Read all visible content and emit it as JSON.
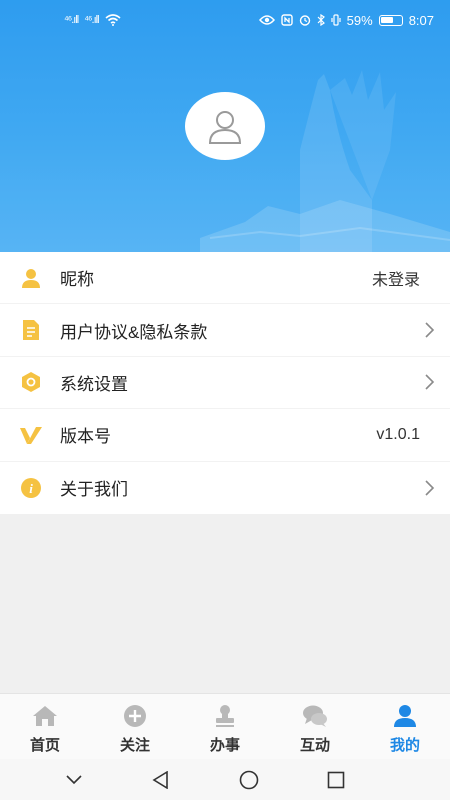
{
  "status_bar": {
    "signal_1": "⁴⁶.ıll",
    "signal_2": "⁴⁶.ıll",
    "battery_percent": "59%",
    "time": "8:07",
    "icons": [
      "wifi-icon",
      "eye-icon",
      "nfc-icon",
      "alarm-icon",
      "bluetooth-icon",
      "vibrate-icon",
      "battery-icon"
    ]
  },
  "header": {
    "background_color": "#3aa6f2",
    "avatar_icon": "user-avatar-icon"
  },
  "menu": {
    "items": [
      {
        "icon": "person-icon",
        "label": "昵称",
        "value": "未登录",
        "chevron": false
      },
      {
        "icon": "document-icon",
        "label": "用户协议&隐私条款",
        "value": "",
        "chevron": true
      },
      {
        "icon": "settings-hex-icon",
        "label": "系统设置",
        "value": "",
        "chevron": true
      },
      {
        "icon": "version-v-icon",
        "label": "版本号",
        "value": "v1.0.1",
        "chevron": false
      },
      {
        "icon": "info-icon",
        "label": "关于我们",
        "value": "",
        "chevron": true
      }
    ],
    "icon_color": "#f5c242"
  },
  "tabbar": {
    "tabs": [
      {
        "icon": "home-icon",
        "label": "首页",
        "active": false
      },
      {
        "icon": "plus-circle-icon",
        "label": "关注",
        "active": false
      },
      {
        "icon": "stamp-icon",
        "label": "办事",
        "active": false
      },
      {
        "icon": "chat-icon",
        "label": "互动",
        "active": false
      },
      {
        "icon": "profile-icon",
        "label": "我的",
        "active": true
      }
    ],
    "active_color": "#1e88e5",
    "inactive_icon_color": "#b8b8b8"
  },
  "navbar": {
    "buttons": [
      "collapse-icon",
      "back-icon",
      "home-circle-icon",
      "recents-icon"
    ]
  }
}
